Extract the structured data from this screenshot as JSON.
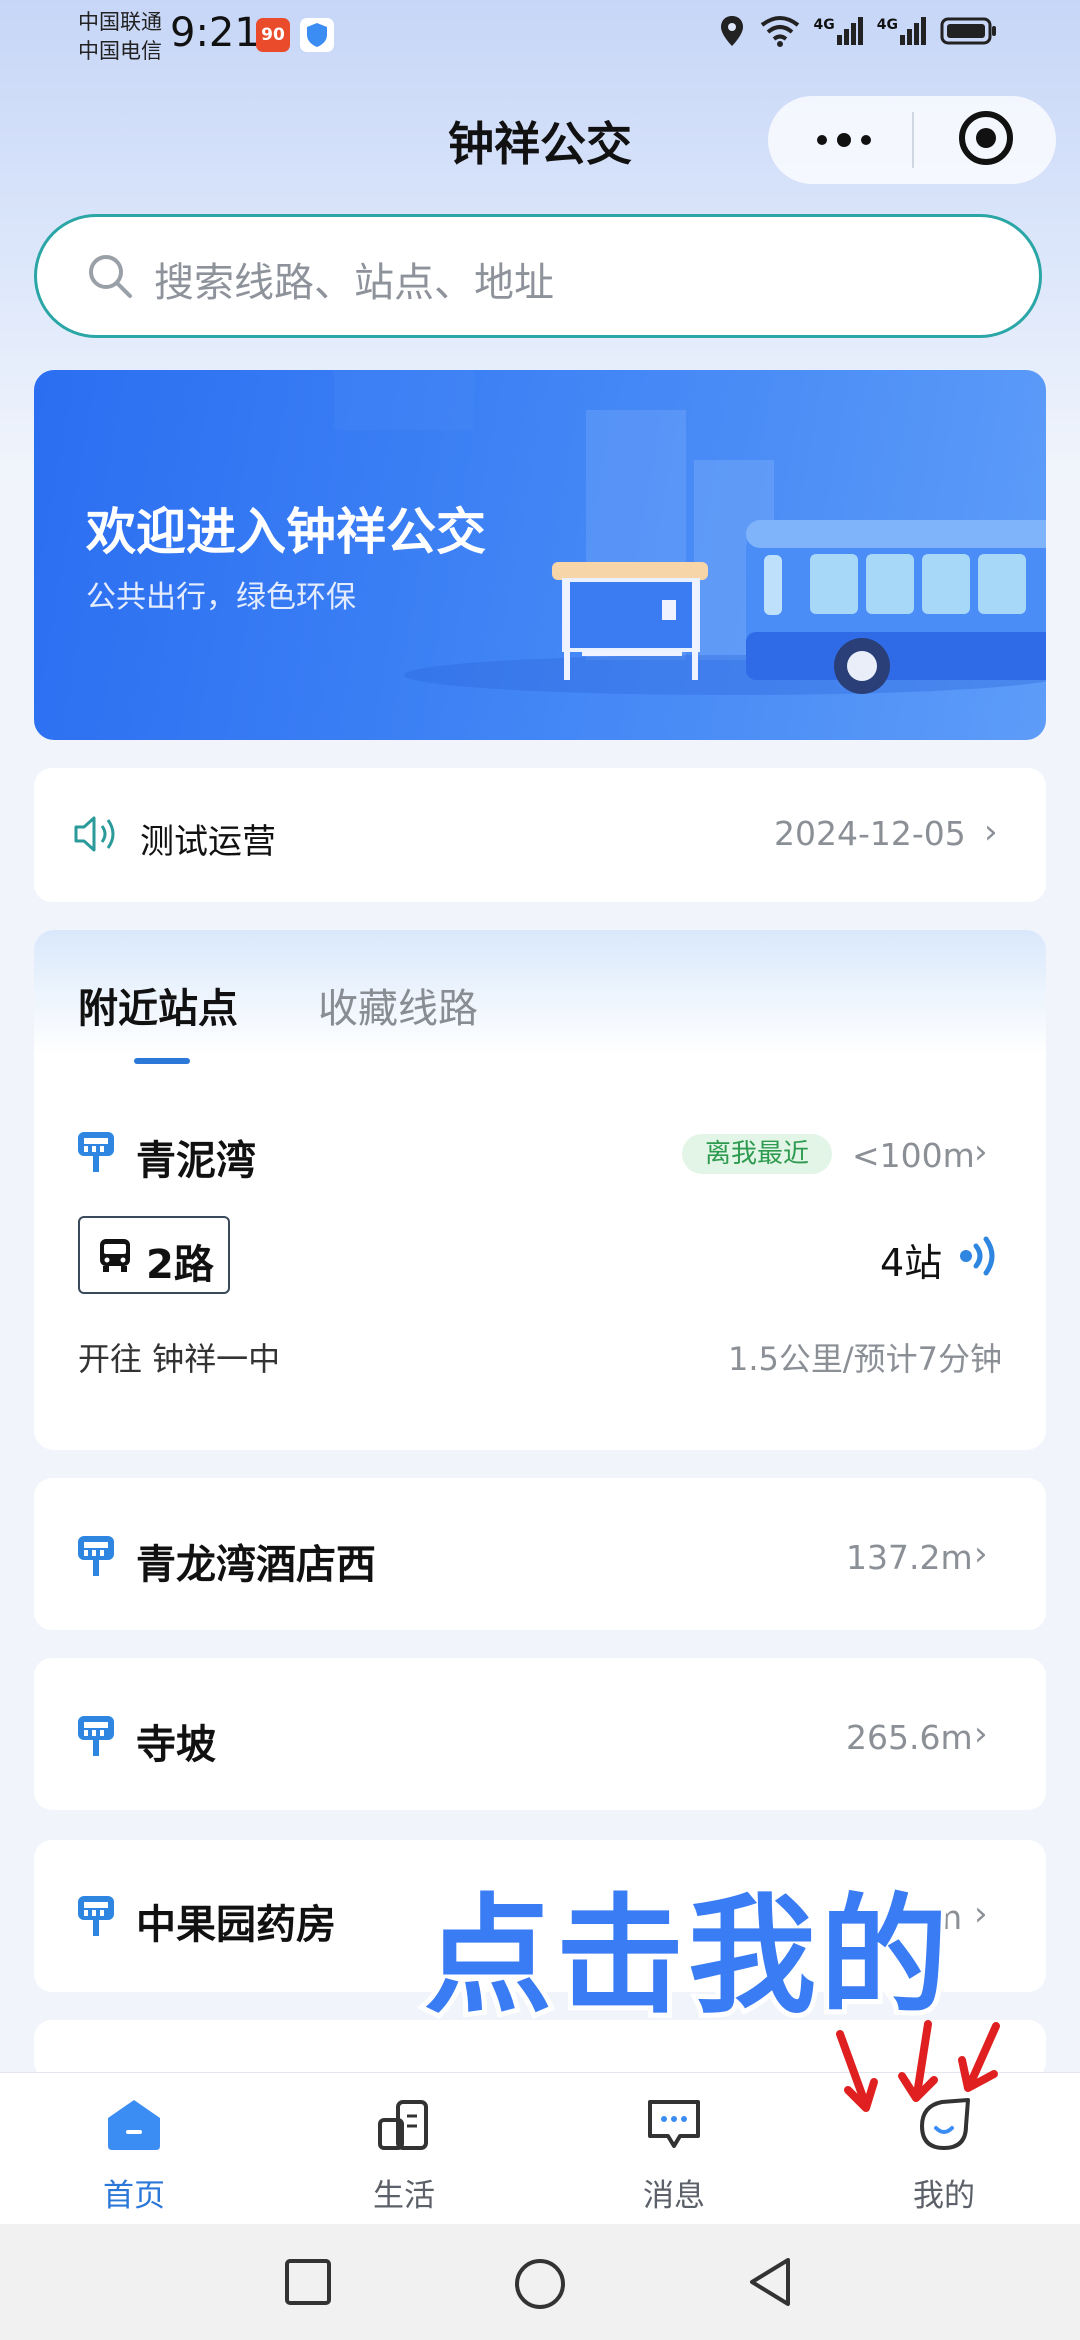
{
  "status_bar": {
    "carrier_1": "中国联通",
    "carrier_2": "中国电信",
    "time": "9:21",
    "icons": [
      "app-icon-red",
      "shield-app-icon",
      "location-icon",
      "wifi-icon",
      "signal-4g-icon",
      "signal-4g-icon",
      "battery-icon"
    ],
    "net_1": "4G",
    "net_2": "4G"
  },
  "header": {
    "title": "钟祥公交",
    "more_icon": "more-dots-icon",
    "close_icon": "target-circle-icon"
  },
  "search": {
    "placeholder": "搜索线路、站点、地址",
    "icon": "search-icon"
  },
  "banner": {
    "title": "欢迎进入钟祥公交",
    "subtitle": "公共出行，绿色环保",
    "colors": {
      "start": "#2b6ef1",
      "end": "#5d9cf8"
    }
  },
  "notice": {
    "icon": "speaker-icon",
    "text": "测试运营",
    "date": "2024-12-05"
  },
  "tabs": {
    "active": "附近站点",
    "inactive": "收藏线路"
  },
  "nearest_station": {
    "name": "青泥湾",
    "badge": "离我最近",
    "distance": "<100m",
    "route": "2路",
    "stops_away": "4站",
    "toward": "开往 钟祥一中",
    "eta": "1.5公里/预计7分钟"
  },
  "stations": [
    {
      "name": "青龙湾酒店西",
      "distance": "137.2m"
    },
    {
      "name": "寺坡",
      "distance": "265.6m"
    },
    {
      "name": "中果园药房",
      "distance": "m"
    }
  ],
  "overlay": {
    "text": "点击我的"
  },
  "bottom_nav": [
    {
      "label": "首页",
      "icon": "home-icon",
      "active": true
    },
    {
      "label": "生活",
      "icon": "life-icon",
      "active": false
    },
    {
      "label": "消息",
      "icon": "message-icon",
      "active": false
    },
    {
      "label": "我的",
      "icon": "profile-icon",
      "active": false
    }
  ],
  "colors": {
    "accent": "#2b78d8",
    "teal_border": "#2aa6a6",
    "badge_green": "#2f9b50",
    "arrow_red": "#e02020"
  }
}
